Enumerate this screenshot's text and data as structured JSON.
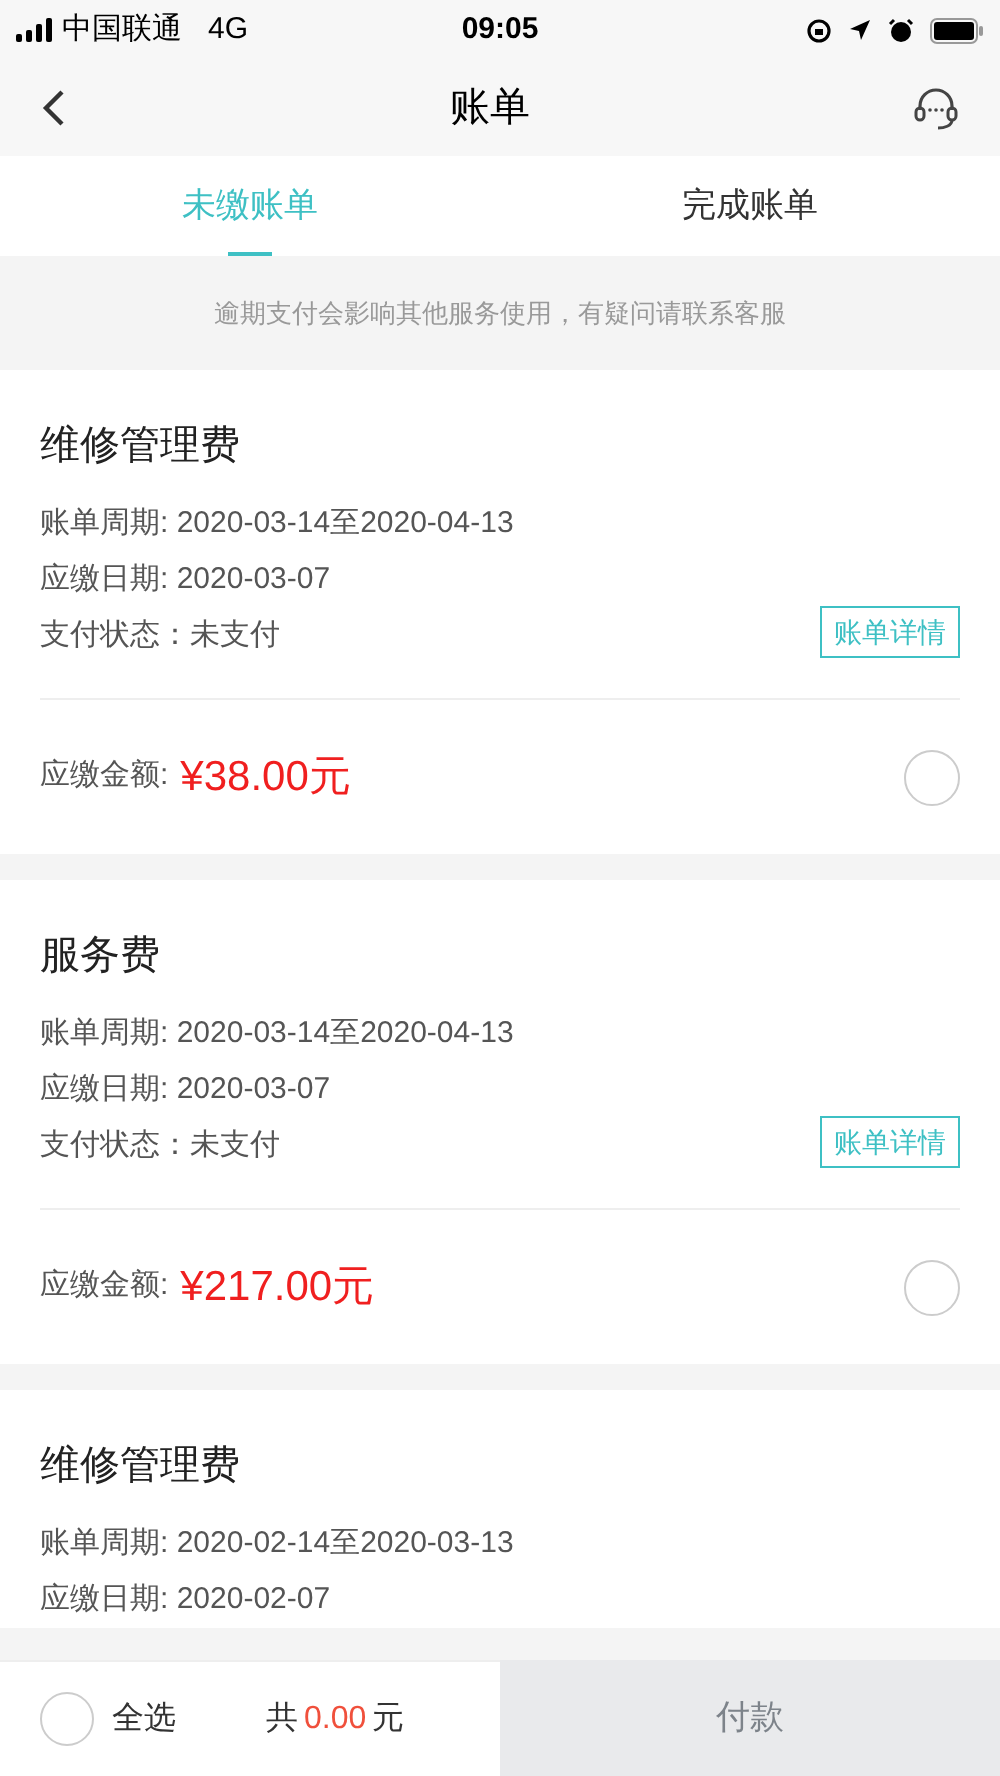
{
  "status_bar": {
    "carrier": "中国联通",
    "network": "4G",
    "time": "09:05"
  },
  "nav": {
    "title": "账单"
  },
  "tabs": [
    {
      "label": "未缴账单",
      "selected": true
    },
    {
      "label": "完成账单",
      "selected": false
    }
  ],
  "notice": "逾期支付会影响其他服务使用，有疑问请联系客服",
  "bills": [
    {
      "title": "维修管理费",
      "lines": [
        "账单周期: 2020-03-14至2020-04-13",
        "应缴日期: 2020-03-07",
        "支付状态：未支付"
      ],
      "detail_button": "账单详情",
      "amount_label": "应缴金额:",
      "amount": "¥38.00元",
      "selected": false
    },
    {
      "title": "服务费",
      "lines": [
        "账单周期: 2020-03-14至2020-04-13",
        "应缴日期: 2020-03-07",
        "支付状态：未支付"
      ],
      "detail_button": "账单详情",
      "amount_label": "应缴金额:",
      "amount": "¥217.00元",
      "selected": false
    },
    {
      "title": "维修管理费",
      "lines": [
        "账单周期: 2020-02-14至2020-03-13",
        "应缴日期: 2020-02-07"
      ]
    }
  ],
  "footer": {
    "select_all": {
      "label": "全选",
      "checked": false
    },
    "total_prefix": "共",
    "total": "0.00",
    "total_suffix": "元",
    "pay_button": "付款"
  }
}
